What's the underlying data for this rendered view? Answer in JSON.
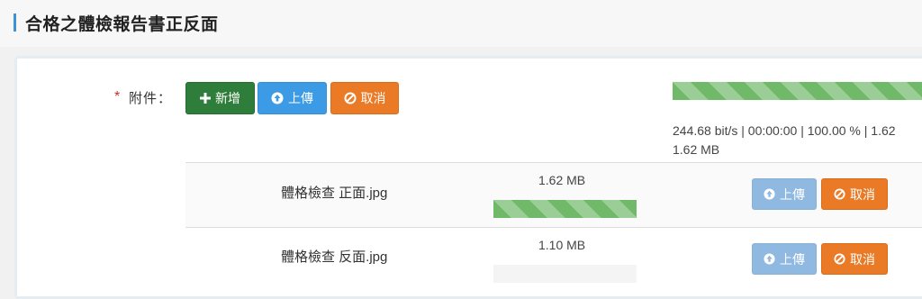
{
  "page": {
    "title": "合格之體檢報告書正反面"
  },
  "form": {
    "required_mark": "*",
    "label": "附件："
  },
  "toolbar": {
    "add_label": "新增",
    "upload_label": "上傳",
    "cancel_label": "取消"
  },
  "overall": {
    "progress": 1.0,
    "stats_line1": "244.68 bit/s | 00:00:00 | 100.00 % | 1.62",
    "stats_line2": "1.62 MB"
  },
  "files": [
    {
      "name": "體格檢查 正面.jpg",
      "size": "1.62 MB",
      "progress": 1.0,
      "upload_label": "上傳",
      "cancel_label": "取消"
    },
    {
      "name": "體格檢查 反面.jpg",
      "size": "1.10 MB",
      "progress": 0.0,
      "upload_label": "上傳",
      "cancel_label": "取消"
    }
  ],
  "colors": {
    "accent": "#3d92d8",
    "green": "#2e7d3a",
    "blue": "#3d9be5",
    "orange": "#ea7a26",
    "progress": "#70b968"
  }
}
